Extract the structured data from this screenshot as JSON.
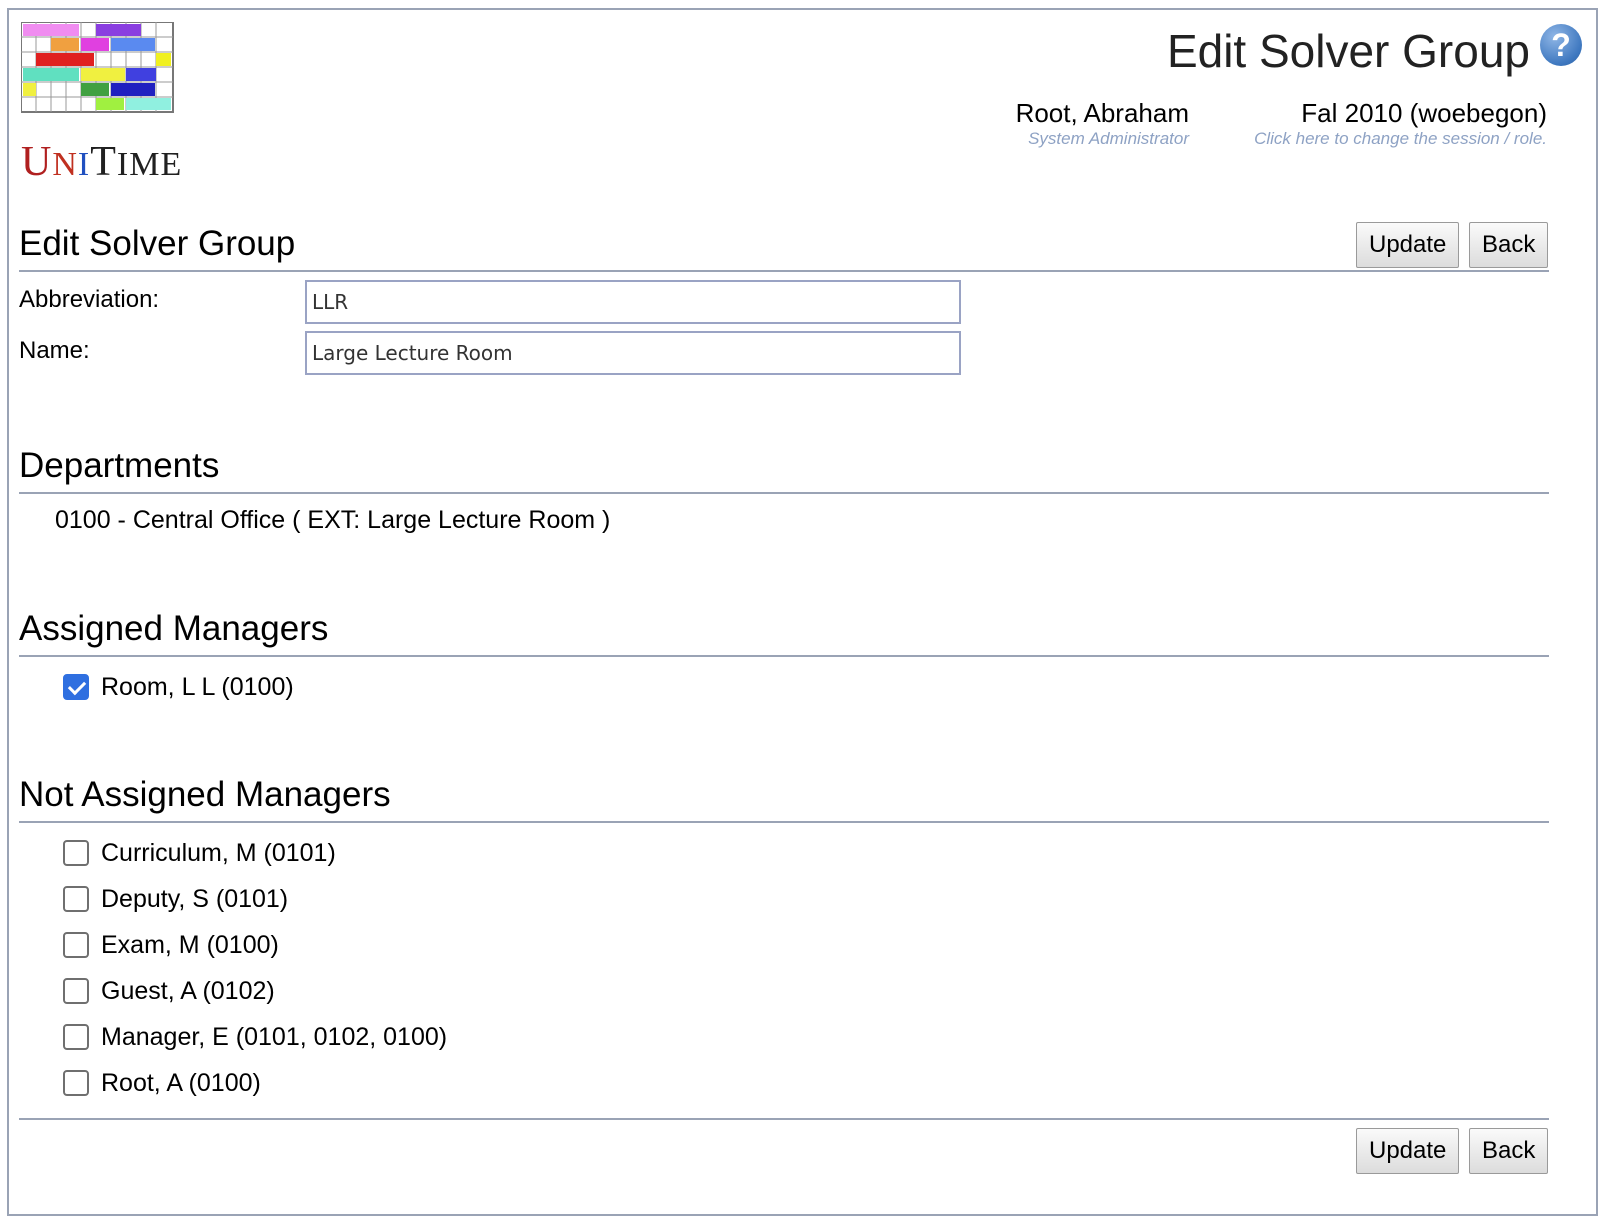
{
  "header": {
    "logo_text": "UniTime",
    "title": "Edit Solver Group",
    "help_icon": "help-icon",
    "user": {
      "name": "Root, Abraham",
      "role": "System Administrator"
    },
    "session": {
      "name": "Fal 2010 (woebegon)",
      "hint": "Click here to change the session / role."
    }
  },
  "form": {
    "title": "Edit Solver Group",
    "update_label": "Update",
    "back_label": "Back",
    "abbreviation_label": "Abbreviation:",
    "abbreviation_value": "LLR",
    "name_label": "Name:",
    "name_value": "Large Lecture Room"
  },
  "departments": {
    "title": "Departments",
    "items": [
      "0100 - Central Office ( EXT: Large Lecture Room )"
    ]
  },
  "assigned": {
    "title": "Assigned Managers",
    "items": [
      {
        "label": "Room, L L (0100)",
        "checked": true
      }
    ]
  },
  "not_assigned": {
    "title": "Not Assigned Managers",
    "items": [
      {
        "label": "Curriculum, M (0101)",
        "checked": false
      },
      {
        "label": "Deputy, S (0101)",
        "checked": false
      },
      {
        "label": "Exam, M (0100)",
        "checked": false
      },
      {
        "label": "Guest, A (0102)",
        "checked": false
      },
      {
        "label": "Manager, E (0101, 0102, 0100)",
        "checked": false
      },
      {
        "label": "Root, A (0100)",
        "checked": false
      }
    ]
  },
  "footer": {
    "update_label": "Update",
    "back_label": "Back"
  },
  "colors": {
    "accent": "#2f6fe0",
    "rule": "#9aa3b5",
    "hint": "#8ea2c4"
  }
}
